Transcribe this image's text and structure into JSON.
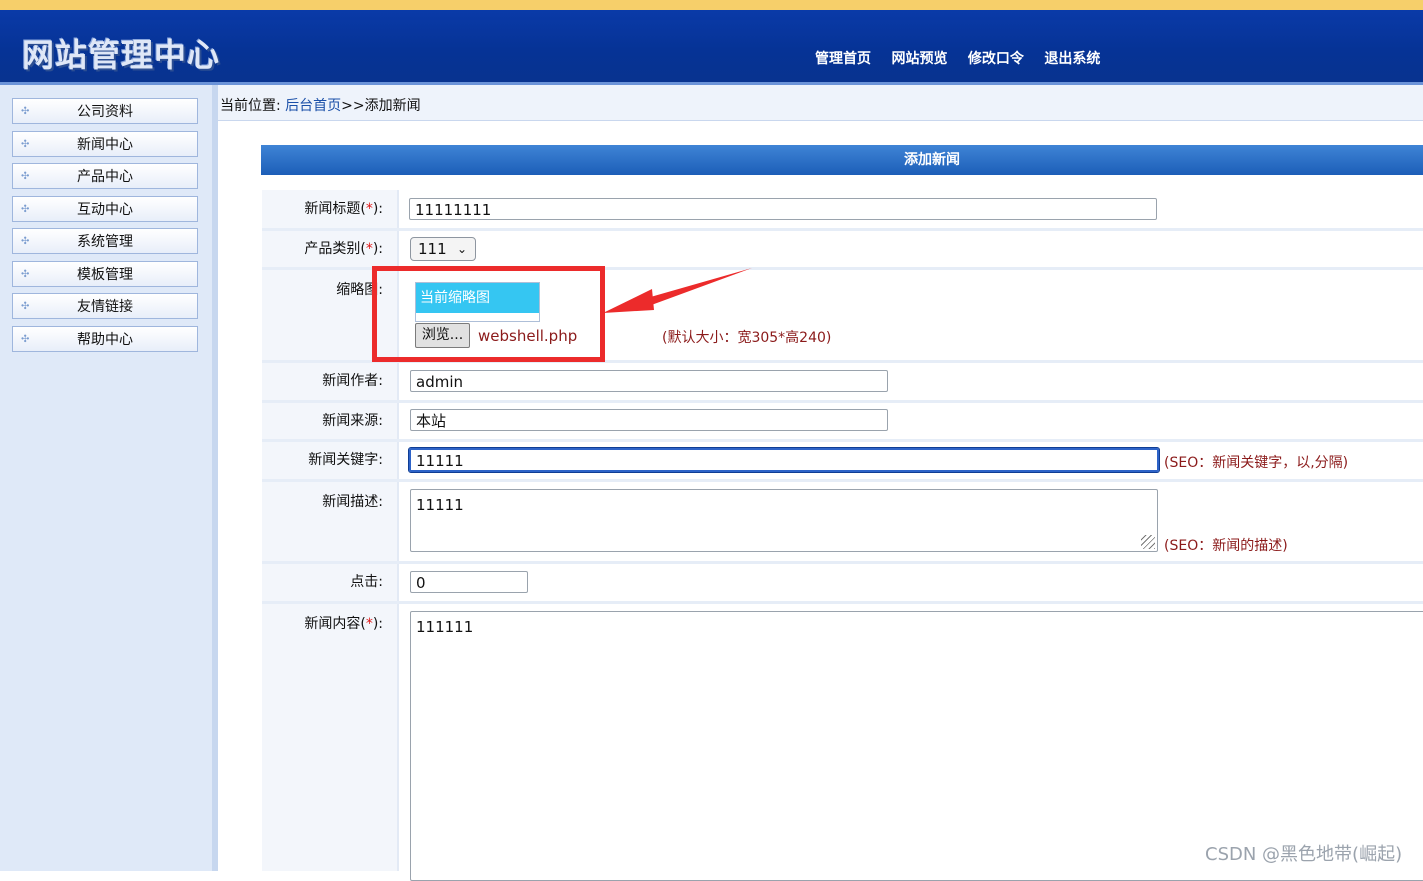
{
  "header": {
    "logo": "网站管理中心",
    "nav": [
      "管理首页",
      "网站预览",
      "修改口令",
      "退出系统"
    ]
  },
  "sidebar": {
    "items": [
      "公司资料",
      "新闻中心",
      "产品中心",
      "互动中心",
      "系统管理",
      "模板管理",
      "友情链接",
      "帮助中心"
    ]
  },
  "breadcrumb": {
    "prefix": "当前位置: ",
    "home": "后台首页",
    "sep": ">>",
    "current": "添加新闻"
  },
  "form": {
    "title": "添加新闻",
    "req_mark": "*",
    "title_field": {
      "label_pre": "新闻标题(",
      "label_post": "):",
      "value": "11111111"
    },
    "category": {
      "label_pre": "产品类别(",
      "label_post": "):",
      "selected": "111"
    },
    "thumbnail": {
      "label": "缩略图:",
      "current_label": "当前缩略图",
      "browse_label": "浏览...",
      "filename": "webshell.php",
      "hint": "(默认大小：宽305*高240)"
    },
    "author": {
      "label": "新闻作者:",
      "value": "admin"
    },
    "source": {
      "label": "新闻来源:",
      "value": "本站"
    },
    "keywords": {
      "label": "新闻关键字:",
      "value": "11111",
      "hint": "(SEO：新闻关键字，以,分隔)"
    },
    "description": {
      "label": "新闻描述:",
      "value": "11111",
      "hint": "(SEO：新闻的描述)"
    },
    "clicks": {
      "label": "点击:",
      "value": "0"
    },
    "content": {
      "label_pre": "新闻内容(",
      "label_post": "):",
      "value": "111111"
    }
  },
  "annotation": {
    "color": "#ec2b2b"
  },
  "watermark": "CSDN @黑色地带(崛起)"
}
